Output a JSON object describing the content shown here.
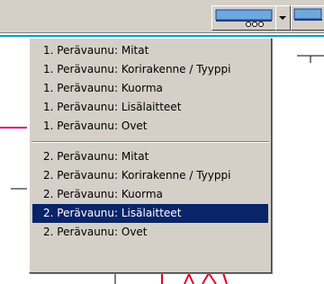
{
  "toolbar": {
    "trailer_button_icon": "trailer-icon",
    "dropdown_icon": "chevron-down-icon",
    "next_button_icon": "trailer-icon"
  },
  "menu": {
    "group1": [
      {
        "label": "1. Perävaunu: Mitat"
      },
      {
        "label": "1. Perävaunu: Korirakenne / Tyyppi"
      },
      {
        "label": "1. Perävaunu: Kuorma"
      },
      {
        "label": "1. Perävaunu: Lisälaitteet"
      },
      {
        "label": "1. Perävaunu: Ovet"
      }
    ],
    "group2": [
      {
        "label": "2. Perävaunu: Mitat"
      },
      {
        "label": "2. Perävaunu: Korirakenne / Tyyppi"
      },
      {
        "label": "2. Perävaunu: Kuorma"
      },
      {
        "label": "2. Perävaunu: Lisälaitteet",
        "selected": true
      },
      {
        "label": "2. Perävaunu: Ovet"
      }
    ]
  },
  "colors": {
    "menu_bg": "#d4d0c8",
    "selection": "#0a246a",
    "accent_line": "#00a0c8",
    "drawing_red": "#e0002a",
    "drawing_magenta": "#e0007a"
  }
}
